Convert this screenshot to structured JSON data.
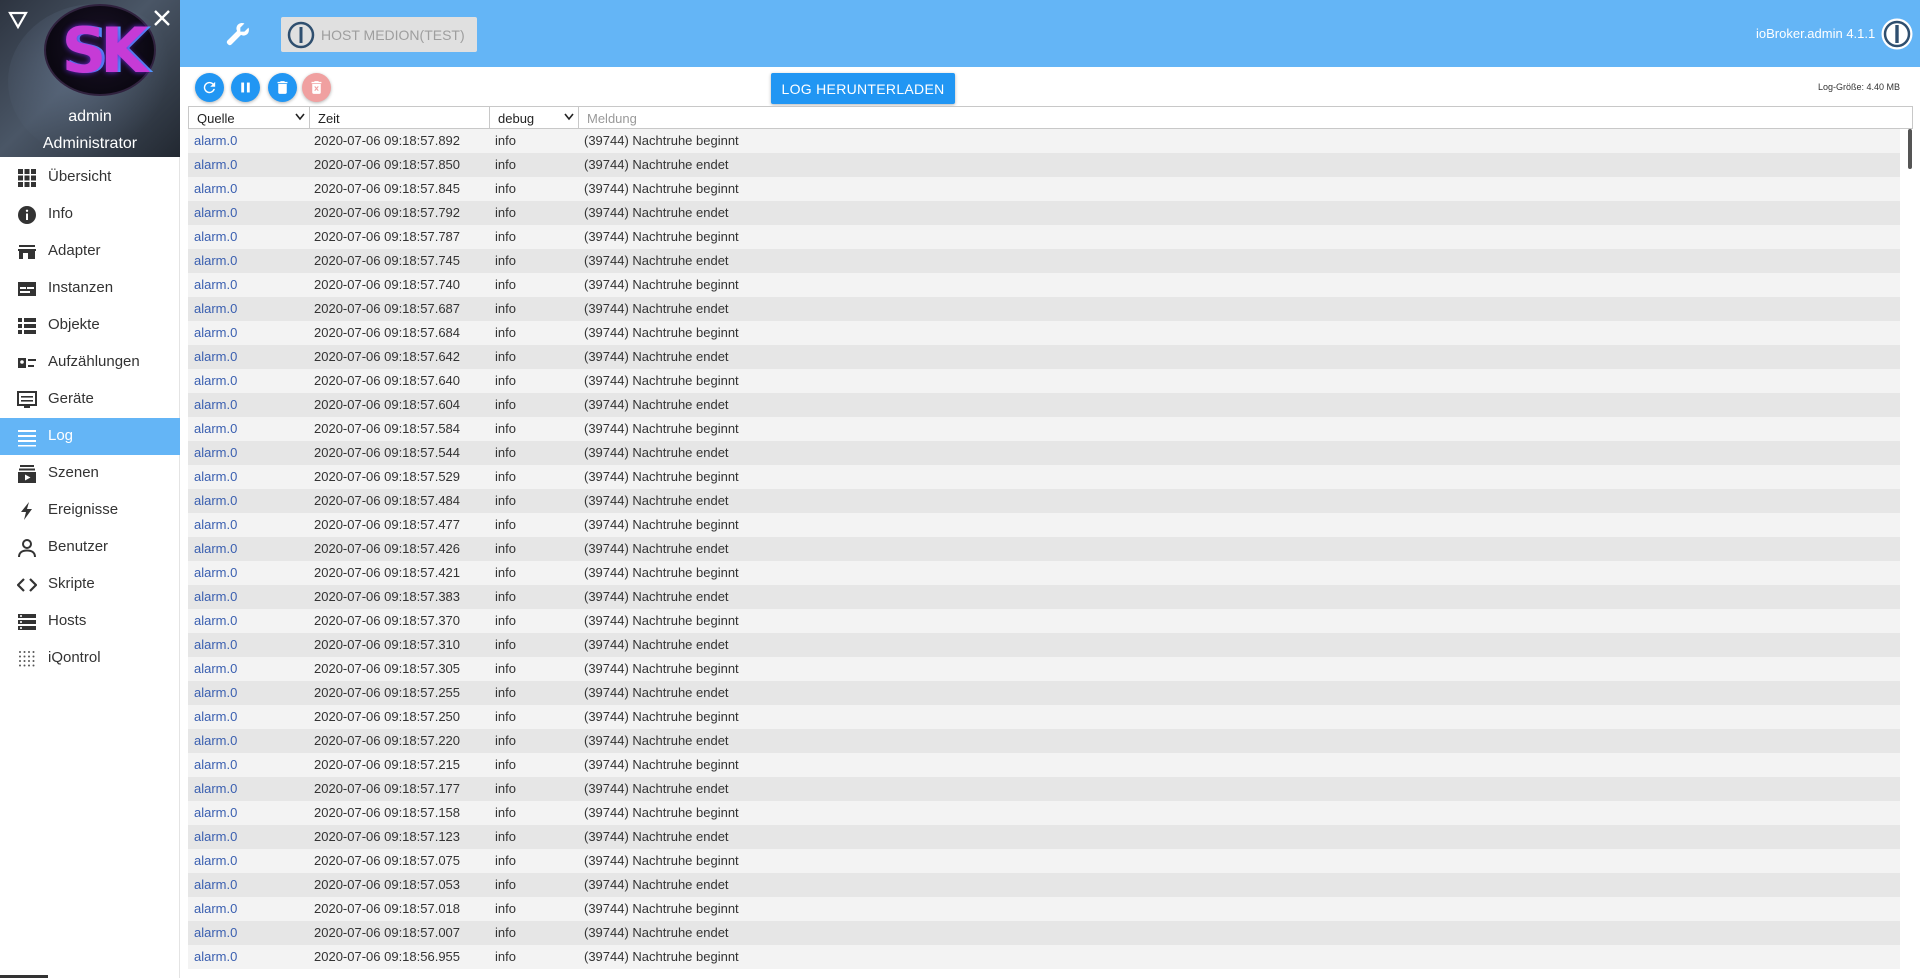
{
  "sidebar": {
    "user_name": "admin",
    "user_role": "Administrator",
    "logo_text": "SK",
    "items": [
      {
        "label": "Übersicht",
        "icon": "grid-icon",
        "active": false
      },
      {
        "label": "Info",
        "icon": "info-icon",
        "active": false
      },
      {
        "label": "Adapter",
        "icon": "store-icon",
        "active": false
      },
      {
        "label": "Instanzen",
        "icon": "instances-icon",
        "active": false
      },
      {
        "label": "Objekte",
        "icon": "list-icon",
        "active": false
      },
      {
        "label": "Aufzählungen",
        "icon": "enum-icon",
        "active": false
      },
      {
        "label": "Geräte",
        "icon": "devices-icon",
        "active": false
      },
      {
        "label": "Log",
        "icon": "log-icon",
        "active": true
      },
      {
        "label": "Szenen",
        "icon": "scenes-icon",
        "active": false
      },
      {
        "label": "Ereignisse",
        "icon": "lightning-icon",
        "active": false
      },
      {
        "label": "Benutzer",
        "icon": "user-icon",
        "active": false
      },
      {
        "label": "Skripte",
        "icon": "code-icon",
        "active": false
      },
      {
        "label": "Hosts",
        "icon": "server-icon",
        "active": false
      },
      {
        "label": "iQontrol",
        "icon": "dots-grid-icon",
        "active": false
      }
    ]
  },
  "topbar": {
    "host_label": "HOST MEDION(TEST)",
    "version": "ioBroker.admin 4.1.1",
    "color": "#64b5f6"
  },
  "toolbar": {
    "download_label": "LOG HERUNTERLADEN",
    "log_size": "Log-Größe: 4.40 MB",
    "accent": "#2196f3"
  },
  "table": {
    "headers": {
      "source": "Quelle",
      "time": "Zeit",
      "level": "debug",
      "message": "Meldung"
    },
    "rows": [
      {
        "source": "alarm.0",
        "time": "2020-07-06 09:18:57.892",
        "level": "info",
        "message": "(39744) Nachtruhe beginnt"
      },
      {
        "source": "alarm.0",
        "time": "2020-07-06 09:18:57.850",
        "level": "info",
        "message": "(39744) Nachtruhe endet"
      },
      {
        "source": "alarm.0",
        "time": "2020-07-06 09:18:57.845",
        "level": "info",
        "message": "(39744) Nachtruhe beginnt"
      },
      {
        "source": "alarm.0",
        "time": "2020-07-06 09:18:57.792",
        "level": "info",
        "message": "(39744) Nachtruhe endet"
      },
      {
        "source": "alarm.0",
        "time": "2020-07-06 09:18:57.787",
        "level": "info",
        "message": "(39744) Nachtruhe beginnt"
      },
      {
        "source": "alarm.0",
        "time": "2020-07-06 09:18:57.745",
        "level": "info",
        "message": "(39744) Nachtruhe endet"
      },
      {
        "source": "alarm.0",
        "time": "2020-07-06 09:18:57.740",
        "level": "info",
        "message": "(39744) Nachtruhe beginnt"
      },
      {
        "source": "alarm.0",
        "time": "2020-07-06 09:18:57.687",
        "level": "info",
        "message": "(39744) Nachtruhe endet"
      },
      {
        "source": "alarm.0",
        "time": "2020-07-06 09:18:57.684",
        "level": "info",
        "message": "(39744) Nachtruhe beginnt"
      },
      {
        "source": "alarm.0",
        "time": "2020-07-06 09:18:57.642",
        "level": "info",
        "message": "(39744) Nachtruhe endet"
      },
      {
        "source": "alarm.0",
        "time": "2020-07-06 09:18:57.640",
        "level": "info",
        "message": "(39744) Nachtruhe beginnt"
      },
      {
        "source": "alarm.0",
        "time": "2020-07-06 09:18:57.604",
        "level": "info",
        "message": "(39744) Nachtruhe endet"
      },
      {
        "source": "alarm.0",
        "time": "2020-07-06 09:18:57.584",
        "level": "info",
        "message": "(39744) Nachtruhe beginnt"
      },
      {
        "source": "alarm.0",
        "time": "2020-07-06 09:18:57.544",
        "level": "info",
        "message": "(39744) Nachtruhe endet"
      },
      {
        "source": "alarm.0",
        "time": "2020-07-06 09:18:57.529",
        "level": "info",
        "message": "(39744) Nachtruhe beginnt"
      },
      {
        "source": "alarm.0",
        "time": "2020-07-06 09:18:57.484",
        "level": "info",
        "message": "(39744) Nachtruhe endet"
      },
      {
        "source": "alarm.0",
        "time": "2020-07-06 09:18:57.477",
        "level": "info",
        "message": "(39744) Nachtruhe beginnt"
      },
      {
        "source": "alarm.0",
        "time": "2020-07-06 09:18:57.426",
        "level": "info",
        "message": "(39744) Nachtruhe endet"
      },
      {
        "source": "alarm.0",
        "time": "2020-07-06 09:18:57.421",
        "level": "info",
        "message": "(39744) Nachtruhe beginnt"
      },
      {
        "source": "alarm.0",
        "time": "2020-07-06 09:18:57.383",
        "level": "info",
        "message": "(39744) Nachtruhe endet"
      },
      {
        "source": "alarm.0",
        "time": "2020-07-06 09:18:57.370",
        "level": "info",
        "message": "(39744) Nachtruhe beginnt"
      },
      {
        "source": "alarm.0",
        "time": "2020-07-06 09:18:57.310",
        "level": "info",
        "message": "(39744) Nachtruhe endet"
      },
      {
        "source": "alarm.0",
        "time": "2020-07-06 09:18:57.305",
        "level": "info",
        "message": "(39744) Nachtruhe beginnt"
      },
      {
        "source": "alarm.0",
        "time": "2020-07-06 09:18:57.255",
        "level": "info",
        "message": "(39744) Nachtruhe endet"
      },
      {
        "source": "alarm.0",
        "time": "2020-07-06 09:18:57.250",
        "level": "info",
        "message": "(39744) Nachtruhe beginnt"
      },
      {
        "source": "alarm.0",
        "time": "2020-07-06 09:18:57.220",
        "level": "info",
        "message": "(39744) Nachtruhe endet"
      },
      {
        "source": "alarm.0",
        "time": "2020-07-06 09:18:57.215",
        "level": "info",
        "message": "(39744) Nachtruhe beginnt"
      },
      {
        "source": "alarm.0",
        "time": "2020-07-06 09:18:57.177",
        "level": "info",
        "message": "(39744) Nachtruhe endet"
      },
      {
        "source": "alarm.0",
        "time": "2020-07-06 09:18:57.158",
        "level": "info",
        "message": "(39744) Nachtruhe beginnt"
      },
      {
        "source": "alarm.0",
        "time": "2020-07-06 09:18:57.123",
        "level": "info",
        "message": "(39744) Nachtruhe endet"
      },
      {
        "source": "alarm.0",
        "time": "2020-07-06 09:18:57.075",
        "level": "info",
        "message": "(39744) Nachtruhe beginnt"
      },
      {
        "source": "alarm.0",
        "time": "2020-07-06 09:18:57.053",
        "level": "info",
        "message": "(39744) Nachtruhe endet"
      },
      {
        "source": "alarm.0",
        "time": "2020-07-06 09:18:57.018",
        "level": "info",
        "message": "(39744) Nachtruhe beginnt"
      },
      {
        "source": "alarm.0",
        "time": "2020-07-06 09:18:57.007",
        "level": "info",
        "message": "(39744) Nachtruhe endet"
      },
      {
        "source": "alarm.0",
        "time": "2020-07-06 09:18:56.955",
        "level": "info",
        "message": "(39744) Nachtruhe beginnt"
      }
    ]
  }
}
